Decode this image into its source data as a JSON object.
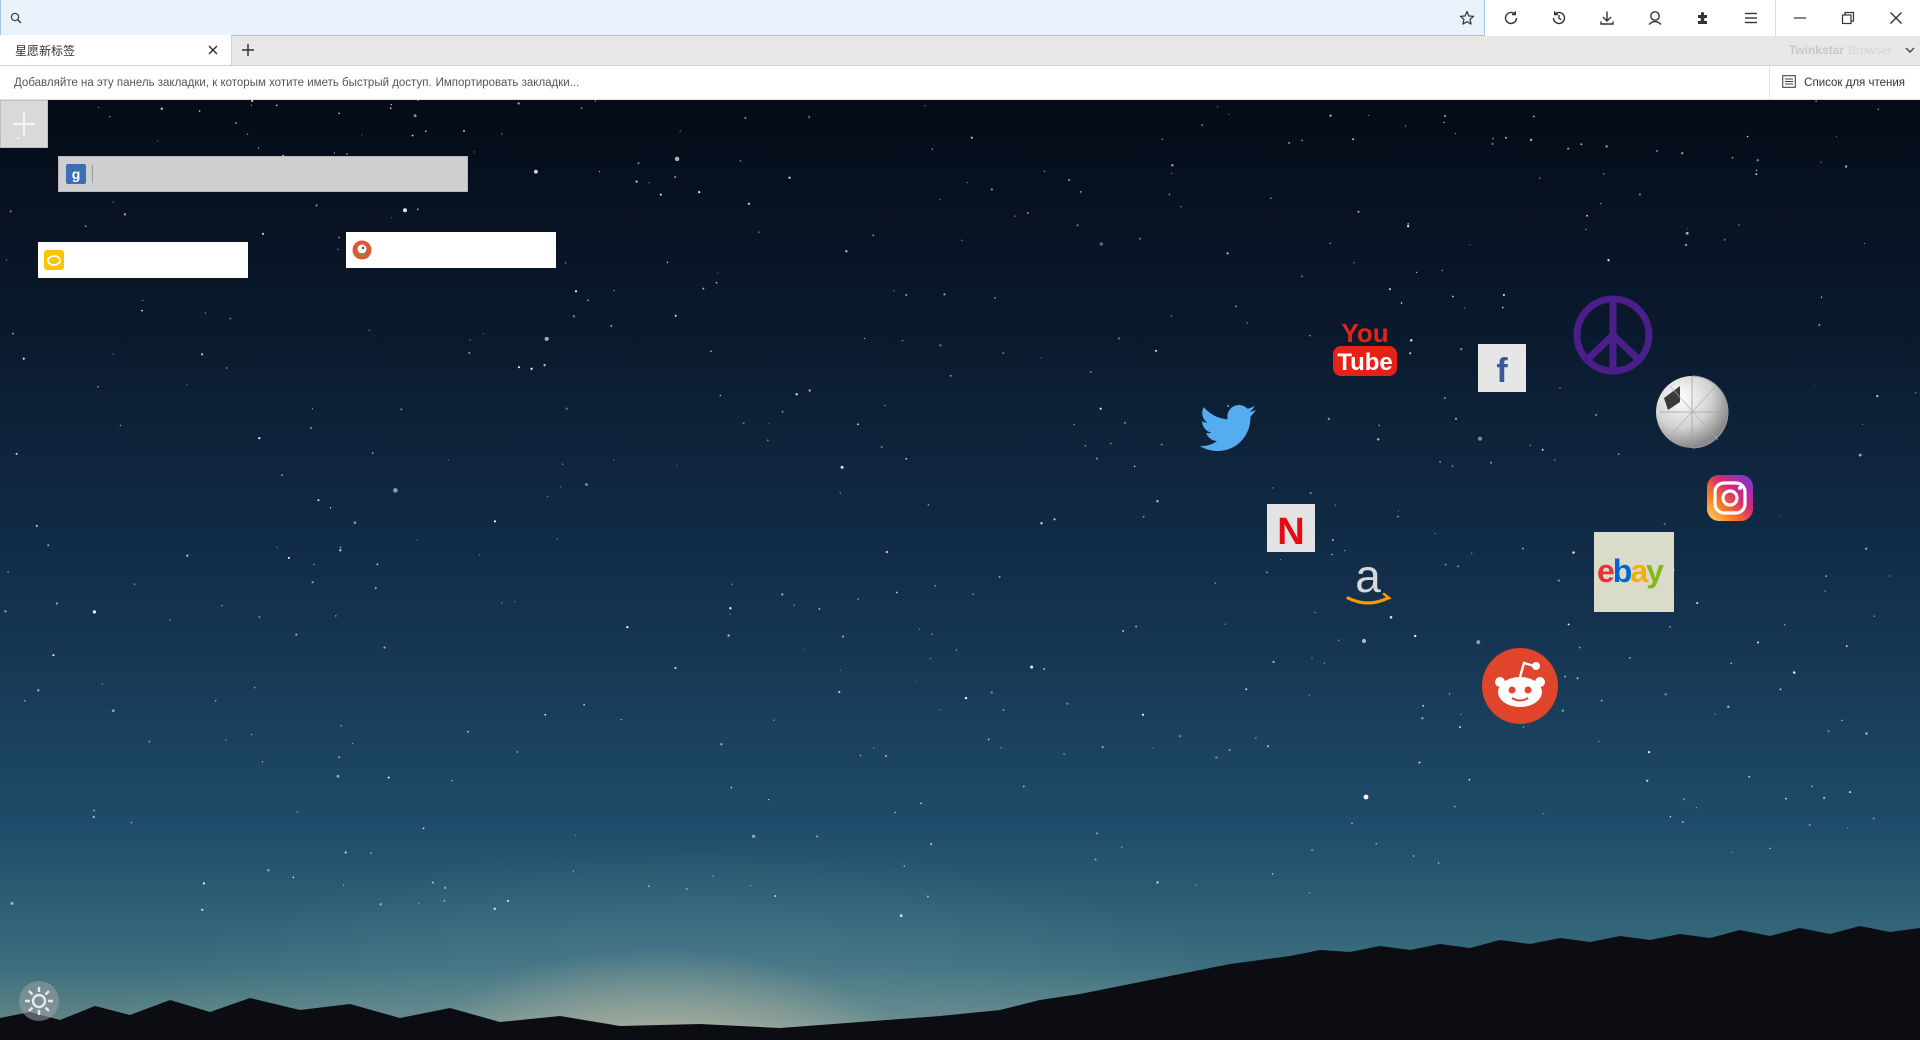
{
  "browser": {
    "address": {
      "value": "",
      "placeholder": ""
    },
    "toolbar_icons": [
      "search-icon",
      "star-icon",
      "reload-icon",
      "history-icon",
      "download-icon",
      "account-icon",
      "extensions-icon",
      "menu-icon"
    ],
    "window_controls": [
      "minimize-icon",
      "restore-icon",
      "close-icon"
    ],
    "brand": {
      "name": "Twinkstar",
      "sub": "Browser"
    }
  },
  "tabs": [
    {
      "label": "星愿新标签",
      "active": true
    }
  ],
  "bookmarks_bar": {
    "hint": "Добавляйте на эту панель закладки, к которым хотите иметь быстрый доступ.",
    "import_link": "Импортировать закладки...",
    "reading_list": "Список для чтения"
  },
  "newtab": {
    "search_boxes": [
      {
        "engine": "Google",
        "icon": "google-icon",
        "value": ""
      },
      {
        "engine": "Yandex",
        "icon": "yandex-icon",
        "value": ""
      },
      {
        "engine": "DuckDuckGo",
        "icon": "duckduckgo-icon",
        "value": ""
      }
    ],
    "tiles": [
      {
        "name": "YouTube",
        "icon": "youtube-icon",
        "text_top": "You",
        "text_bottom": "Tube"
      },
      {
        "name": "Facebook",
        "icon": "facebook-icon",
        "text": "f"
      },
      {
        "name": "Peace",
        "icon": "peace-icon"
      },
      {
        "name": "Twitter",
        "icon": "twitter-icon"
      },
      {
        "name": "Wikipedia",
        "icon": "wikipedia-icon"
      },
      {
        "name": "Instagram",
        "icon": "instagram-icon"
      },
      {
        "name": "Netflix",
        "icon": "netflix-icon",
        "text": "N"
      },
      {
        "name": "Amazon",
        "icon": "amazon-icon",
        "text": "a"
      },
      {
        "name": "eBay",
        "icon": "ebay-icon",
        "letters": [
          "e",
          "b",
          "a",
          "y"
        ]
      },
      {
        "name": "Reddit",
        "icon": "reddit-icon"
      }
    ],
    "colors": {
      "youtube_red": "#e62117",
      "facebook_blue": "#3b5998",
      "peace_purple": "#4b1f8a",
      "twitter_blue": "#55acee",
      "netflix_red": "#e50914",
      "amazon_orange": "#ff9900",
      "reddit_orange": "#ff4500",
      "ebay_red": "#e53238",
      "ebay_blue": "#0064d2",
      "ebay_yellow": "#f5af02",
      "ebay_green": "#86b817"
    }
  }
}
